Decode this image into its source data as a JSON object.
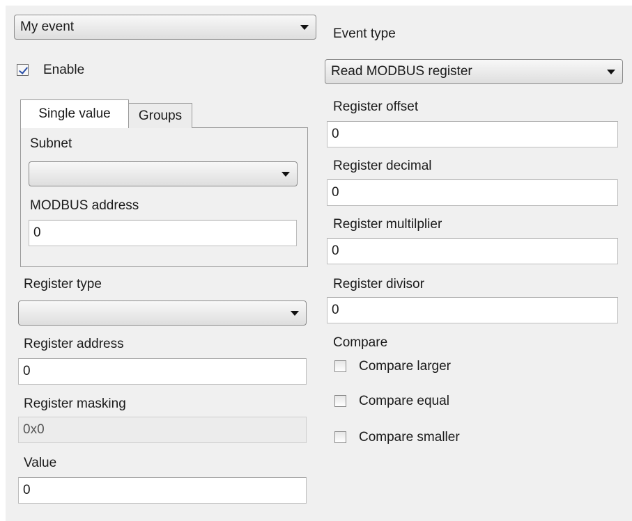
{
  "event_combo": {
    "value": "My event"
  },
  "enable": {
    "label": "Enable",
    "checked": true
  },
  "tabs": [
    {
      "label": "Single value",
      "active": true
    },
    {
      "label": "Groups",
      "active": false
    }
  ],
  "single_value": {
    "subnet_label": "Subnet",
    "subnet_value": "",
    "modbus_address_label": "MODBUS address",
    "modbus_address_value": "0"
  },
  "register_type": {
    "label": "Register type",
    "value": ""
  },
  "register_address": {
    "label": "Register address",
    "value": "0"
  },
  "register_masking": {
    "label": "Register masking",
    "value": "0x0"
  },
  "value_field": {
    "label": "Value",
    "value": "0"
  },
  "event_type": {
    "label": "Event type",
    "value": "Read MODBUS register"
  },
  "register_offset": {
    "label": "Register offset",
    "value": "0"
  },
  "register_decimal": {
    "label": "Register decimal",
    "value": "0"
  },
  "register_multiplier": {
    "label": "Register multilplier",
    "value": "0"
  },
  "register_divisor": {
    "label": "Register divisor",
    "value": "0"
  },
  "compare": {
    "label": "Compare",
    "options": [
      {
        "label": "Compare larger",
        "checked": false
      },
      {
        "label": "Compare equal",
        "checked": false
      },
      {
        "label": "Compare smaller",
        "checked": false
      }
    ]
  }
}
